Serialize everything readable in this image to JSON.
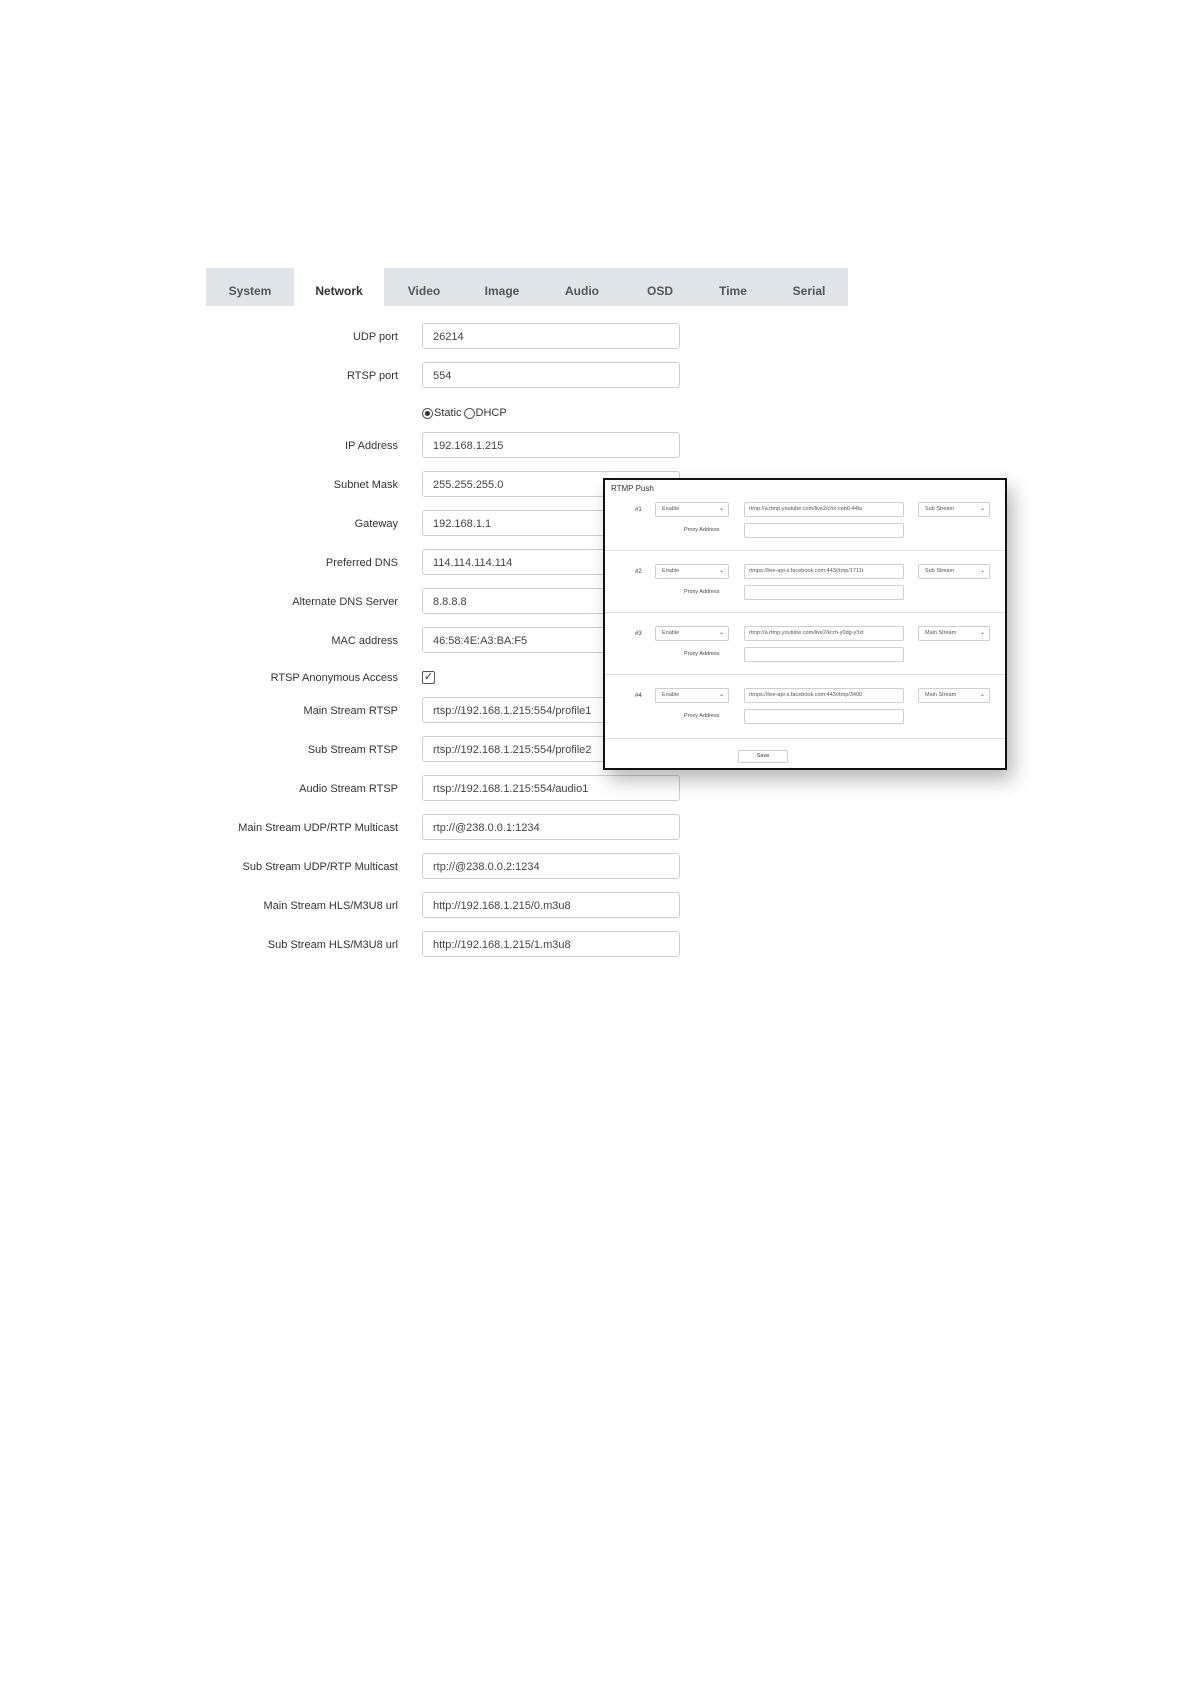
{
  "tabs": [
    {
      "label": "System"
    },
    {
      "label": "Network"
    },
    {
      "label": "Video"
    },
    {
      "label": "Image"
    },
    {
      "label": "Audio"
    },
    {
      "label": "OSD"
    },
    {
      "label": "Time"
    },
    {
      "label": "Serial"
    }
  ],
  "active_tab": "Network",
  "form": {
    "udp_port": {
      "label": "UDP port",
      "value": "26214"
    },
    "rtsp_port": {
      "label": "RTSP port",
      "value": "554"
    },
    "ip_mode": {
      "static_label": "Static",
      "dhcp_label": "DHCP",
      "selected": "Static"
    },
    "ip_address": {
      "label": "IP Address",
      "value": "192.168.1.215"
    },
    "subnet_mask": {
      "label": "Subnet Mask",
      "value": "255.255.255.0"
    },
    "gateway": {
      "label": "Gateway",
      "value": "192.168.1.1"
    },
    "preferred_dns": {
      "label": "Preferred DNS",
      "value": "114.114.114.114"
    },
    "alternate_dns": {
      "label": "Alternate DNS Server",
      "value": "8.8.8.8"
    },
    "mac_address": {
      "label": "MAC address",
      "value": "46:58:4E:A3:BA:F5"
    },
    "rtsp_anonymous": {
      "label": "RTSP Anonymous Access",
      "checked": true,
      "check_glyph": "✓"
    },
    "main_rtsp": {
      "label": "Main Stream RTSP",
      "value": "rtsp://192.168.1.215:554/profile1"
    },
    "sub_rtsp": {
      "label": "Sub Stream RTSP",
      "value": "rtsp://192.168.1.215:554/profile2"
    },
    "audio_rtsp": {
      "label": "Audio Stream RTSP",
      "value": "rtsp://192.168.1.215:554/audio1"
    },
    "main_multicast": {
      "label": "Main Stream UDP/RTP Multicast",
      "value": "rtp://@238.0.0.1:1234"
    },
    "sub_multicast": {
      "label": "Sub Stream UDP/RTP Multicast",
      "value": "rtp://@238.0.0.2:1234"
    },
    "main_hls": {
      "label": "Main Stream HLS/M3U8 url",
      "value": "http://192.168.1.215/0.m3u8"
    },
    "sub_hls": {
      "label": "Sub Stream HLS/M3U8 url",
      "value": "http://192.168.1.215/1.m3u8"
    }
  },
  "rtmp": {
    "title": "RTMP Push",
    "proxy_label": "Proxy Address",
    "save_label": "Save",
    "entries": [
      {
        "num": "#1",
        "enable": "Enable",
        "url": "rtmp://a.rtmp.youtube.com/live2/chx-ceb6-44tu",
        "stream": "Sub Stream",
        "proxy": ""
      },
      {
        "num": "#2",
        "enable": "Enable",
        "url": "rtmps://live-api-s.facebook.com:443/rtmp/1711t",
        "stream": "Sub Stream",
        "proxy": ""
      },
      {
        "num": "#3",
        "enable": "Enable",
        "url": "rtmp://a.rtmp.youtube.com/live2/kcrh-y0dg-y3xt",
        "stream": "Main Stream",
        "proxy": ""
      },
      {
        "num": "#4",
        "enable": "Enable",
        "url": "rtmps://live-api-s.facebook.com:443/rtmp/3400",
        "stream": "Main Stream",
        "proxy": ""
      }
    ]
  },
  "icons": {
    "chevron": "⌄"
  }
}
